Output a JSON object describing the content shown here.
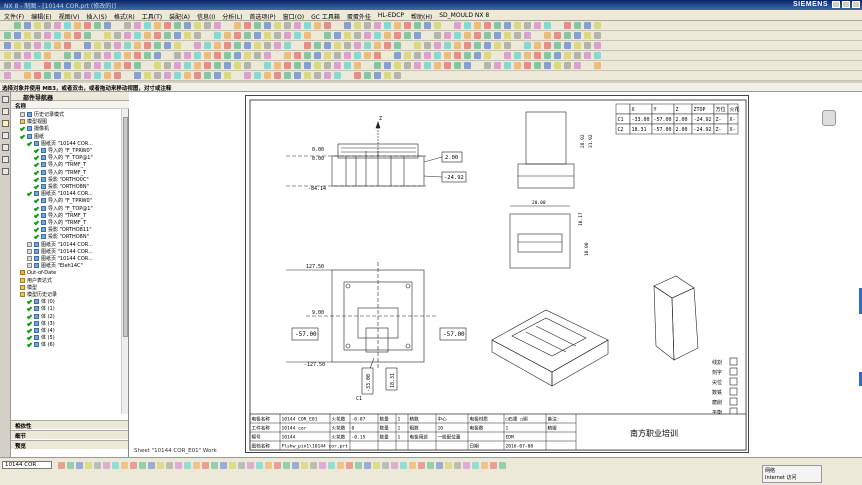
{
  "window": {
    "title": "NX 8 - 制图 - [10144 COR.prt (修改的)]",
    "brand": "SIEMENS"
  },
  "menu": [
    "文件(F)",
    "编辑(E)",
    "视图(V)",
    "插入(S)",
    "格式(R)",
    "工具(T)",
    "装配(A)",
    "信息(I)",
    "分析(L)",
    "首选项(P)",
    "窗口(O)",
    "GC 工具箱",
    "蛋蛋外挂",
    "HL-EDCP",
    "帮助(H)",
    "SD_MOULD NX 8"
  ],
  "prompt": "选择对象并使用 MB3，或者双击，或者拖动来移动视图，对寸或注释",
  "navigator": {
    "title": "部件导航器",
    "column": "名称",
    "rows": [
      {
        "label": "历史记录模式",
        "indent": 1,
        "icon": "ghost"
      },
      {
        "label": "模型视图",
        "indent": 1,
        "icon": "folder"
      },
      {
        "label": "摄像机",
        "indent": 1,
        "icon": "green"
      },
      {
        "label": "图纸",
        "indent": 1,
        "icon": "green"
      },
      {
        "label": "图纸页 \"10144 COR...",
        "indent": 2,
        "icon": "green"
      },
      {
        "label": "导入的 \"F_TPRW0\"",
        "indent": 3,
        "icon": "green"
      },
      {
        "label": "导入的 \"F_TOP@1\"",
        "indent": 3,
        "icon": "green"
      },
      {
        "label": "导入的 \"TRMF_T",
        "indent": 3,
        "icon": "green"
      },
      {
        "label": "导入的 \"TRMF_T",
        "indent": 3,
        "icon": "green"
      },
      {
        "label": "投影 \"ORTHO0C\"",
        "indent": 3,
        "icon": "green"
      },
      {
        "label": "投影 \"ORTHO8N\"",
        "indent": 3,
        "icon": "green"
      },
      {
        "label": "图纸页 \"10144 COR...",
        "indent": 2,
        "icon": "green"
      },
      {
        "label": "导入的 \"F_TPRW0\"",
        "indent": 3,
        "icon": "green"
      },
      {
        "label": "导入的 \"F_TOP@1\"",
        "indent": 3,
        "icon": "green"
      },
      {
        "label": "导入的 \"TRMF_T",
        "indent": 3,
        "icon": "green"
      },
      {
        "label": "导入的 \"TRMF_T",
        "indent": 3,
        "icon": "green"
      },
      {
        "label": "投影 \"ORTHO811\"",
        "indent": 3,
        "icon": "green"
      },
      {
        "label": "投影 \"ORTHO8N\"",
        "indent": 3,
        "icon": "green"
      },
      {
        "label": "图纸页 \"10144 COR...",
        "indent": 2,
        "icon": "ghost"
      },
      {
        "label": "图纸页 \"10144 COR...",
        "indent": 2,
        "icon": "ghost"
      },
      {
        "label": "图纸页 \"10144 COR...",
        "indent": 2,
        "icon": "ghost"
      },
      {
        "label": "图纸页 \"Eleh14C\"",
        "indent": 2,
        "icon": "ghost"
      },
      {
        "label": "Out-of-Date",
        "indent": 1,
        "icon": "orange"
      },
      {
        "label": "用户表达式",
        "indent": 1,
        "icon": "folder"
      },
      {
        "label": "模型",
        "indent": 1,
        "icon": "folder"
      },
      {
        "label": "模型历史记录",
        "indent": 1,
        "icon": "folder"
      },
      {
        "label": "体 (0)",
        "indent": 2,
        "icon": "green"
      },
      {
        "label": "体 (1)",
        "indent": 2,
        "icon": "green"
      },
      {
        "label": "体 (2)",
        "indent": 2,
        "icon": "green"
      },
      {
        "label": "体 (3)",
        "indent": 2,
        "icon": "green"
      },
      {
        "label": "体 (4)",
        "indent": 2,
        "icon": "green"
      },
      {
        "label": "体 (5)",
        "indent": 2,
        "icon": "green"
      },
      {
        "label": "体 (6)",
        "indent": 2,
        "icon": "green"
      }
    ],
    "panels": [
      "相依性",
      "细节",
      "预览"
    ]
  },
  "drawing": {
    "top_dims": {
      "zero1": "0.00",
      "zero2": "0.00",
      "neg84": "-84.14",
      "box_200": "2.00",
      "box_2492": "-24.92"
    },
    "front_dims": {
      "d2892": "28.92",
      "d3192": "31.92"
    },
    "mid_dims": {
      "d2000": "20.00",
      "d1017": "10.17",
      "d1000": "10.00"
    },
    "plan_dims": {
      "y12750": "127.50",
      "y900": "9.00",
      "yneg12750": "-127.50",
      "box_l": "-57.00",
      "box_r": "-57.00",
      "box_b1": "-33.00",
      "box_b2": "18.31",
      "axis_z": "Z",
      "axis_c1": "C1"
    },
    "coord_table": {
      "headers": [
        "",
        "X",
        "Y",
        "Z",
        "ZTOP",
        "方位",
        "火花"
      ],
      "rows": [
        [
          "C1",
          "-33.00",
          "-57.00",
          "2.00",
          "-24.92",
          "Z-",
          "X-"
        ],
        [
          "C2",
          "18.31",
          "-57.00",
          "2.00",
          "-24.92",
          "Z-",
          "X-"
        ]
      ]
    },
    "checklist": [
      "线割",
      "刻字",
      "尖位",
      "数铣",
      "磨削",
      "平衡",
      "镀粉"
    ],
    "title_block": {
      "r1": [
        "电极名称",
        "10144 COR_E01",
        "火花数",
        "-0.07",
        "数量",
        "1",
        "精数",
        "中心",
        "电极材质",
        "□石墨 □铜",
        "备注:"
      ],
      "r2": [
        "工件名称",
        "10144 cor",
        "火花数",
        "0",
        "数量",
        "1",
        "粗数",
        "10",
        "电极数",
        "1",
        "精锻"
      ],
      "r3": [
        "模号",
        "10144",
        "火花数",
        "-0.15",
        "数量",
        "1",
        "电极用途",
        "一般配位置",
        "",
        "EDM"
      ],
      "r4": [
        "图档名称",
        "Flshw_pin1\\10144 cor.prt",
        "",
        "",
        "",
        "",
        "",
        "",
        "日期",
        "2016-07-08"
      ],
      "company": "南方职业培训"
    }
  },
  "sheet_tab": "Sheet \"10144 COR_E01\" Work",
  "status": {
    "bottom_select": "10144 COR",
    "tray_label": "网络",
    "tray_sub": "Internet 访问"
  },
  "colors": {
    "accent": "#0a246a",
    "green_check": "#1a9a1a",
    "bg": "#d4d0c8"
  }
}
